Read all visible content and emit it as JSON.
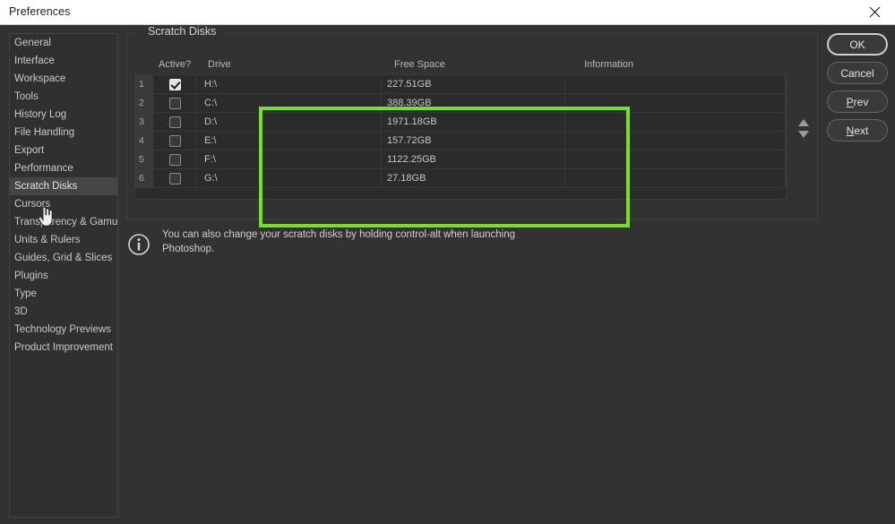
{
  "window": {
    "title": "Preferences",
    "close_icon": "close-icon"
  },
  "sidebar": {
    "items": [
      {
        "label": "General",
        "selected": false
      },
      {
        "label": "Interface",
        "selected": false
      },
      {
        "label": "Workspace",
        "selected": false
      },
      {
        "label": "Tools",
        "selected": false
      },
      {
        "label": "History Log",
        "selected": false
      },
      {
        "label": "File Handling",
        "selected": false
      },
      {
        "label": "Export",
        "selected": false
      },
      {
        "label": "Performance",
        "selected": false
      },
      {
        "label": "Scratch Disks",
        "selected": true
      },
      {
        "label": "Cursors",
        "selected": false
      },
      {
        "label": "Transparency & Gamut",
        "selected": false
      },
      {
        "label": "Units & Rulers",
        "selected": false
      },
      {
        "label": "Guides, Grid & Slices",
        "selected": false
      },
      {
        "label": "Plugins",
        "selected": false
      },
      {
        "label": "Type",
        "selected": false
      },
      {
        "label": "3D",
        "selected": false
      },
      {
        "label": "Technology Previews",
        "selected": false
      },
      {
        "label": "Product Improvement",
        "selected": false
      }
    ]
  },
  "main": {
    "group_title": "Scratch Disks",
    "columns": {
      "active": "Active?",
      "drive": "Drive",
      "free_space": "Free Space",
      "information": "Information"
    },
    "rows": [
      {
        "num": "1",
        "active": true,
        "drive": "H:\\",
        "free_space": "227.51GB",
        "information": ""
      },
      {
        "num": "2",
        "active": false,
        "drive": "C:\\",
        "free_space": "388.39GB",
        "information": ""
      },
      {
        "num": "3",
        "active": false,
        "drive": "D:\\",
        "free_space": "1971.18GB",
        "information": ""
      },
      {
        "num": "4",
        "active": false,
        "drive": "E:\\",
        "free_space": "157.72GB",
        "information": ""
      },
      {
        "num": "5",
        "active": false,
        "drive": "F:\\",
        "free_space": "1122.25GB",
        "information": ""
      },
      {
        "num": "6",
        "active": false,
        "drive": "G:\\",
        "free_space": "27.18GB",
        "information": ""
      }
    ],
    "note": {
      "icon": "info-icon",
      "text": "You can also change your scratch disks by holding control-alt when launching Photoshop."
    },
    "move_up_icon": "arrow-up-icon",
    "move_down_icon": "arrow-down-icon"
  },
  "buttons": {
    "ok": "OK",
    "cancel": "Cancel",
    "prev": "Prev",
    "prev_accel": "P",
    "prev_rest": "rev",
    "next": "Next",
    "next_accel": "N",
    "next_rest": "ext"
  },
  "colors": {
    "highlight": "#76e023",
    "dialog_bg": "#323232",
    "titlebar_bg": "#ffffff",
    "selected_item_bg": "#454545"
  }
}
